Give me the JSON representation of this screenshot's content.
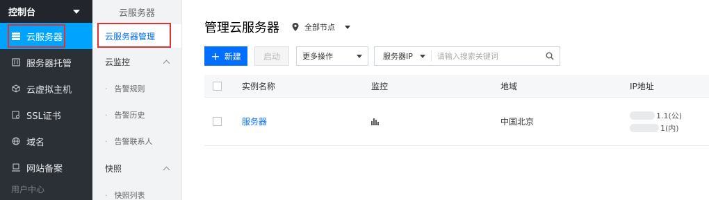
{
  "sidebar": {
    "header": "控制台",
    "items": [
      {
        "label": "云服务器",
        "icon": "server-list-icon"
      },
      {
        "label": "服务器托管",
        "icon": "rack-icon"
      },
      {
        "label": "云虚拟主机",
        "icon": "cube-icon"
      },
      {
        "label": "SSL证书",
        "icon": "certificate-icon"
      },
      {
        "label": "域名",
        "icon": "globe-icon"
      },
      {
        "label": "网站备案",
        "icon": "record-icon"
      }
    ],
    "footer_partial": "用户中心"
  },
  "submenu": {
    "title": "云服务器",
    "active_link": "云服务器管理",
    "groups": [
      {
        "label": "云监控",
        "subs": [
          "告警规则",
          "告警历史",
          "告警联系人"
        ]
      },
      {
        "label": "快照",
        "subs": [
          "快照列表"
        ]
      }
    ]
  },
  "main": {
    "title": "管理云服务器",
    "region": "全部节点",
    "toolbar": {
      "new_label": "新建",
      "start_label": "启动",
      "more_label": "更多操作",
      "search_field": "服务器IP",
      "search_placeholder": "请输入搜索关键词"
    },
    "table": {
      "headers": [
        "实例名称",
        "监控",
        "地域",
        "IP地址"
      ],
      "rows": [
        {
          "name": "服务器",
          "region": "中国北京",
          "ip_public": "1.1(公)",
          "ip_private": "1(内)"
        }
      ]
    }
  },
  "colors": {
    "accent": "#00a4ff",
    "link": "#006eff",
    "highlight": "#e0322f",
    "sidebar_bg": "#2b2f36"
  }
}
